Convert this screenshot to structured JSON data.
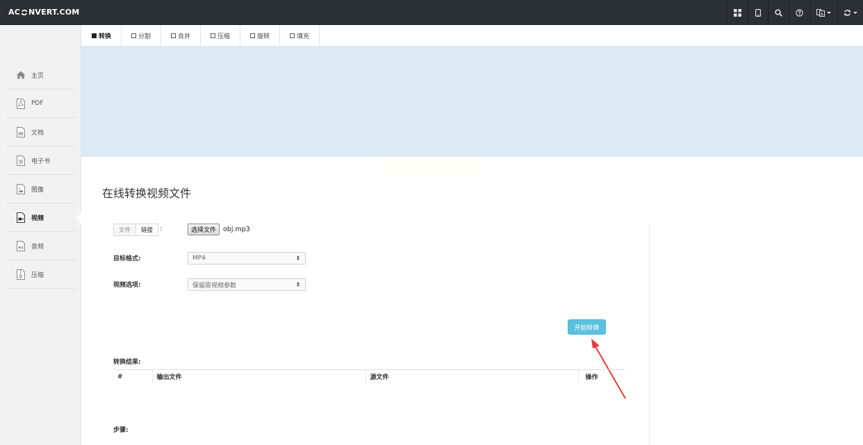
{
  "header": {
    "logo_left": "AC",
    "logo_right": "NVERT.COM",
    "icons": [
      "grid-icon",
      "tablet-icon",
      "search-icon",
      "help-icon",
      "language-icon",
      "refresh-icon"
    ]
  },
  "sidebar": {
    "items": [
      {
        "label": "主页",
        "icon": "home-icon"
      },
      {
        "label": "PDF",
        "icon": "pdf-file-icon"
      },
      {
        "label": "文档",
        "icon": "word-file-icon"
      },
      {
        "label": "电子书",
        "icon": "ebook-file-icon"
      },
      {
        "label": "图像",
        "icon": "image-file-icon"
      },
      {
        "label": "视频",
        "icon": "video-file-icon",
        "active": true
      },
      {
        "label": "音频",
        "icon": "audio-file-icon"
      },
      {
        "label": "压缩",
        "icon": "archive-file-icon"
      }
    ]
  },
  "tabs": [
    {
      "label": "转换",
      "active": true
    },
    {
      "label": "分割"
    },
    {
      "label": "合并"
    },
    {
      "label": "压缩"
    },
    {
      "label": "旋转"
    },
    {
      "label": "填充"
    }
  ],
  "main": {
    "title": "在线转换视频文件",
    "source_options": {
      "file": "文件",
      "link": "链接",
      "colon": ":"
    },
    "choose_file_label": "选择文件",
    "file_name": "obj.mp3",
    "target_format_label": "目标格式:",
    "target_format_value": "MP4",
    "video_options_label": "视频选项:",
    "video_options_value": "保留原视频参数",
    "start_button": "开始转换",
    "result_label": "转换结果:",
    "table_headers": [
      "#",
      "输出文件",
      "源文件",
      "操作"
    ],
    "steps_label": "步骤:"
  },
  "colors": {
    "topbar": "#2b2f36",
    "banner": "#dbeaf5",
    "start_button": "#5bc0de",
    "annotation_arrow": "#e53935"
  }
}
